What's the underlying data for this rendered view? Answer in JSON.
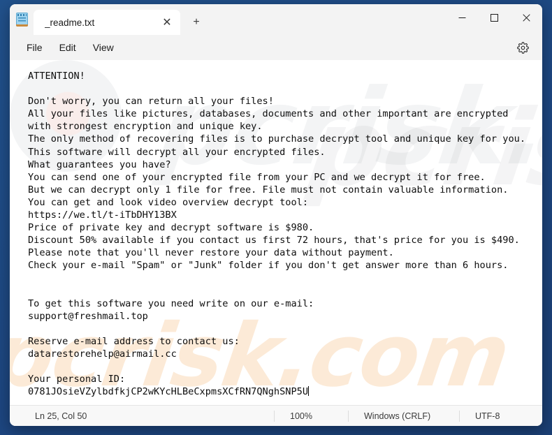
{
  "window": {
    "app_icon": "notepad-icon",
    "controls": {
      "minimize": "─",
      "maximize": "□",
      "close": "✕"
    }
  },
  "tabs": {
    "items": [
      {
        "title": "_readme.txt",
        "close_icon": "✕"
      }
    ],
    "new_tab_icon": "+"
  },
  "menubar": {
    "items": [
      {
        "label": "File"
      },
      {
        "label": "Edit"
      },
      {
        "label": "View"
      }
    ],
    "settings_icon": "gear-icon"
  },
  "editor": {
    "filename": "_readme.txt",
    "content": "ATTENTION!\n\nDon't worry, you can return all your files!\nAll your files like pictures, databases, documents and other important are encrypted\nwith strongest encryption and unique key.\nThe only method of recovering files is to purchase decrypt tool and unique key for you.\nThis software will decrypt all your encrypted files.\nWhat guarantees you have?\nYou can send one of your encrypted file from your PC and we decrypt it for free.\nBut we can decrypt only 1 file for free. File must not contain valuable information.\nYou can get and look video overview decrypt tool:\nhttps://we.tl/t-iTbDHY13BX\nPrice of private key and decrypt software is $980.\nDiscount 50% available if you contact us first 72 hours, that's price for you is $490.\nPlease note that you'll never restore your data without payment.\nCheck your e-mail \"Spam\" or \"Junk\" folder if you don't get answer more than 6 hours.\n\n\nTo get this software you need write on our e-mail:\nsupport@freshmail.top\n\nReserve e-mail address to contact us:\ndatarestorehelp@airmail.cc\n\nYour personal ID:\n0781JOsieVZylbdfkjCP2wKYcHLBeCxpmsXCfRN7QNghSNP5U",
    "ransom_details": {
      "video_url": "https://we.tl/t-iTbDHY13BX",
      "full_price": "$980",
      "discount_price": "$490",
      "discount_percent": "50%",
      "discount_window_hours": "72",
      "reply_window_hours": "6",
      "primary_email": "support@freshmail.top",
      "reserve_email": "datarestorehelp@airmail.cc",
      "personal_id": "0781JOsieVZylbdfkjCP2wKYcHLBeCxpmsXCfRN7QNghSNP5U"
    }
  },
  "statusbar": {
    "position": "Ln 25, Col 50",
    "zoom": "100%",
    "line_ending": "Windows (CRLF)",
    "encoding": "UTF-8"
  },
  "watermark": {
    "text": "pcrisk.com"
  },
  "colors": {
    "desktop": "#1f4e86",
    "window_chrome": "#f3f3f3",
    "editor_bg": "#ffffff",
    "text": "#0d0d0d",
    "close_hover": "#c42b1c"
  }
}
